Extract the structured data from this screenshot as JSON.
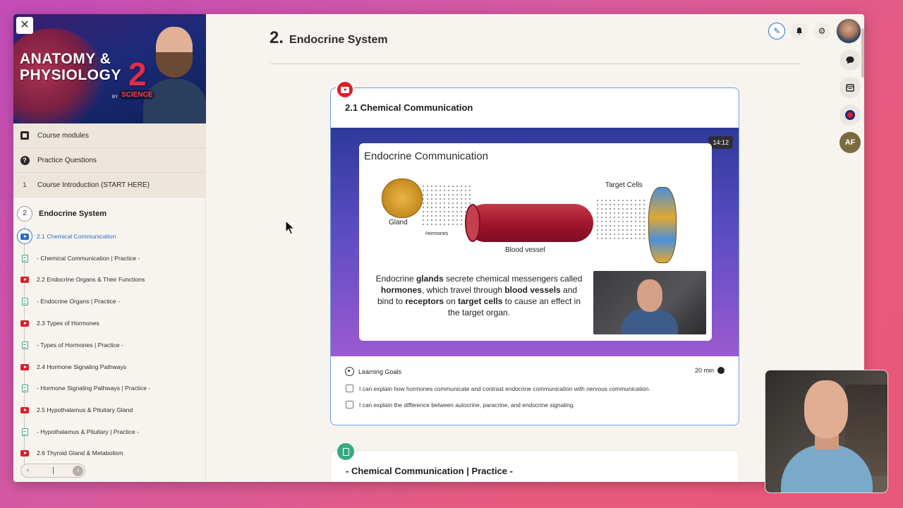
{
  "sidebar": {
    "close_label": "✕",
    "banner": {
      "title_line1": "ANATOMY &",
      "title_line2": "PHYSIOLOGY",
      "number": "2",
      "by": "BY",
      "brand": "SCIENCE"
    },
    "menu": [
      {
        "label": "Course modules",
        "icon": "modules-icon"
      },
      {
        "label": "Practice Questions",
        "icon": "question-icon"
      },
      {
        "label": "Course Introduction (START HERE)",
        "num": "1"
      }
    ],
    "section": {
      "num": "2",
      "title": "Endocrine System"
    },
    "lessons": [
      {
        "label": "2.1 Chemical Communication",
        "type": "video",
        "active": true
      },
      {
        "label": "- Chemical Communication | Practice -",
        "type": "doc"
      },
      {
        "label": "2.2 Endocrine Organs & Their Functions",
        "type": "video"
      },
      {
        "label": "- Endocrine Organs | Practice -",
        "type": "doc"
      },
      {
        "label": "2.3 Types of Hormones",
        "type": "video"
      },
      {
        "label": "- Types of Hormones | Practice -",
        "type": "doc"
      },
      {
        "label": "2.4 Hormone Signaling Pathways",
        "type": "video"
      },
      {
        "label": "- Hormone Signaling Pathways | Practice -",
        "type": "doc"
      },
      {
        "label": "2.5 Hypothalamus & Pituitary Gland",
        "type": "video"
      },
      {
        "label": "- Hypothalamus & Pituitary | Practice -",
        "type": "doc"
      },
      {
        "label": "2.6 Thyroid Gland & Metabolism",
        "type": "video"
      }
    ],
    "pager": {
      "prev": "‹",
      "next": "›"
    }
  },
  "main": {
    "section_number": "2.",
    "section_title": "Endocrine System",
    "card": {
      "title": "2.1 Chemical Communication",
      "duration": "14:12",
      "slide": {
        "title": "Endocrine Communication",
        "gland_label": "Gland",
        "hormones_label": "Hormones",
        "vessel_label": "Blood vessel",
        "target_label": "Target Cells",
        "text_1": "Endocrine ",
        "text_2": "glands",
        "text_3": " secrete chemical messengers called ",
        "text_4": "hormones",
        "text_5": ", which travel through ",
        "text_6": "blood vessels",
        "text_7": " and bind to ",
        "text_8": "receptors",
        "text_9": " on ",
        "text_10": "target cells",
        "text_11": " to cause an effect in the target organ."
      },
      "goals_label": "Learning Goals",
      "goals_time": "20 min",
      "goals": [
        "I can explain how hormones communicate and contrast endocrine communication with nervous communication.",
        "I can explain the difference between autocrine, paracrine, and endocrine signaling."
      ]
    },
    "next_card": {
      "title": "- Chemical Communication | Practice -"
    }
  },
  "toolbar": {
    "pencil": "✎",
    "bell": "🔔",
    "gear": "⚙",
    "chat": "💬",
    "calendar": "▦",
    "af": "AF"
  }
}
